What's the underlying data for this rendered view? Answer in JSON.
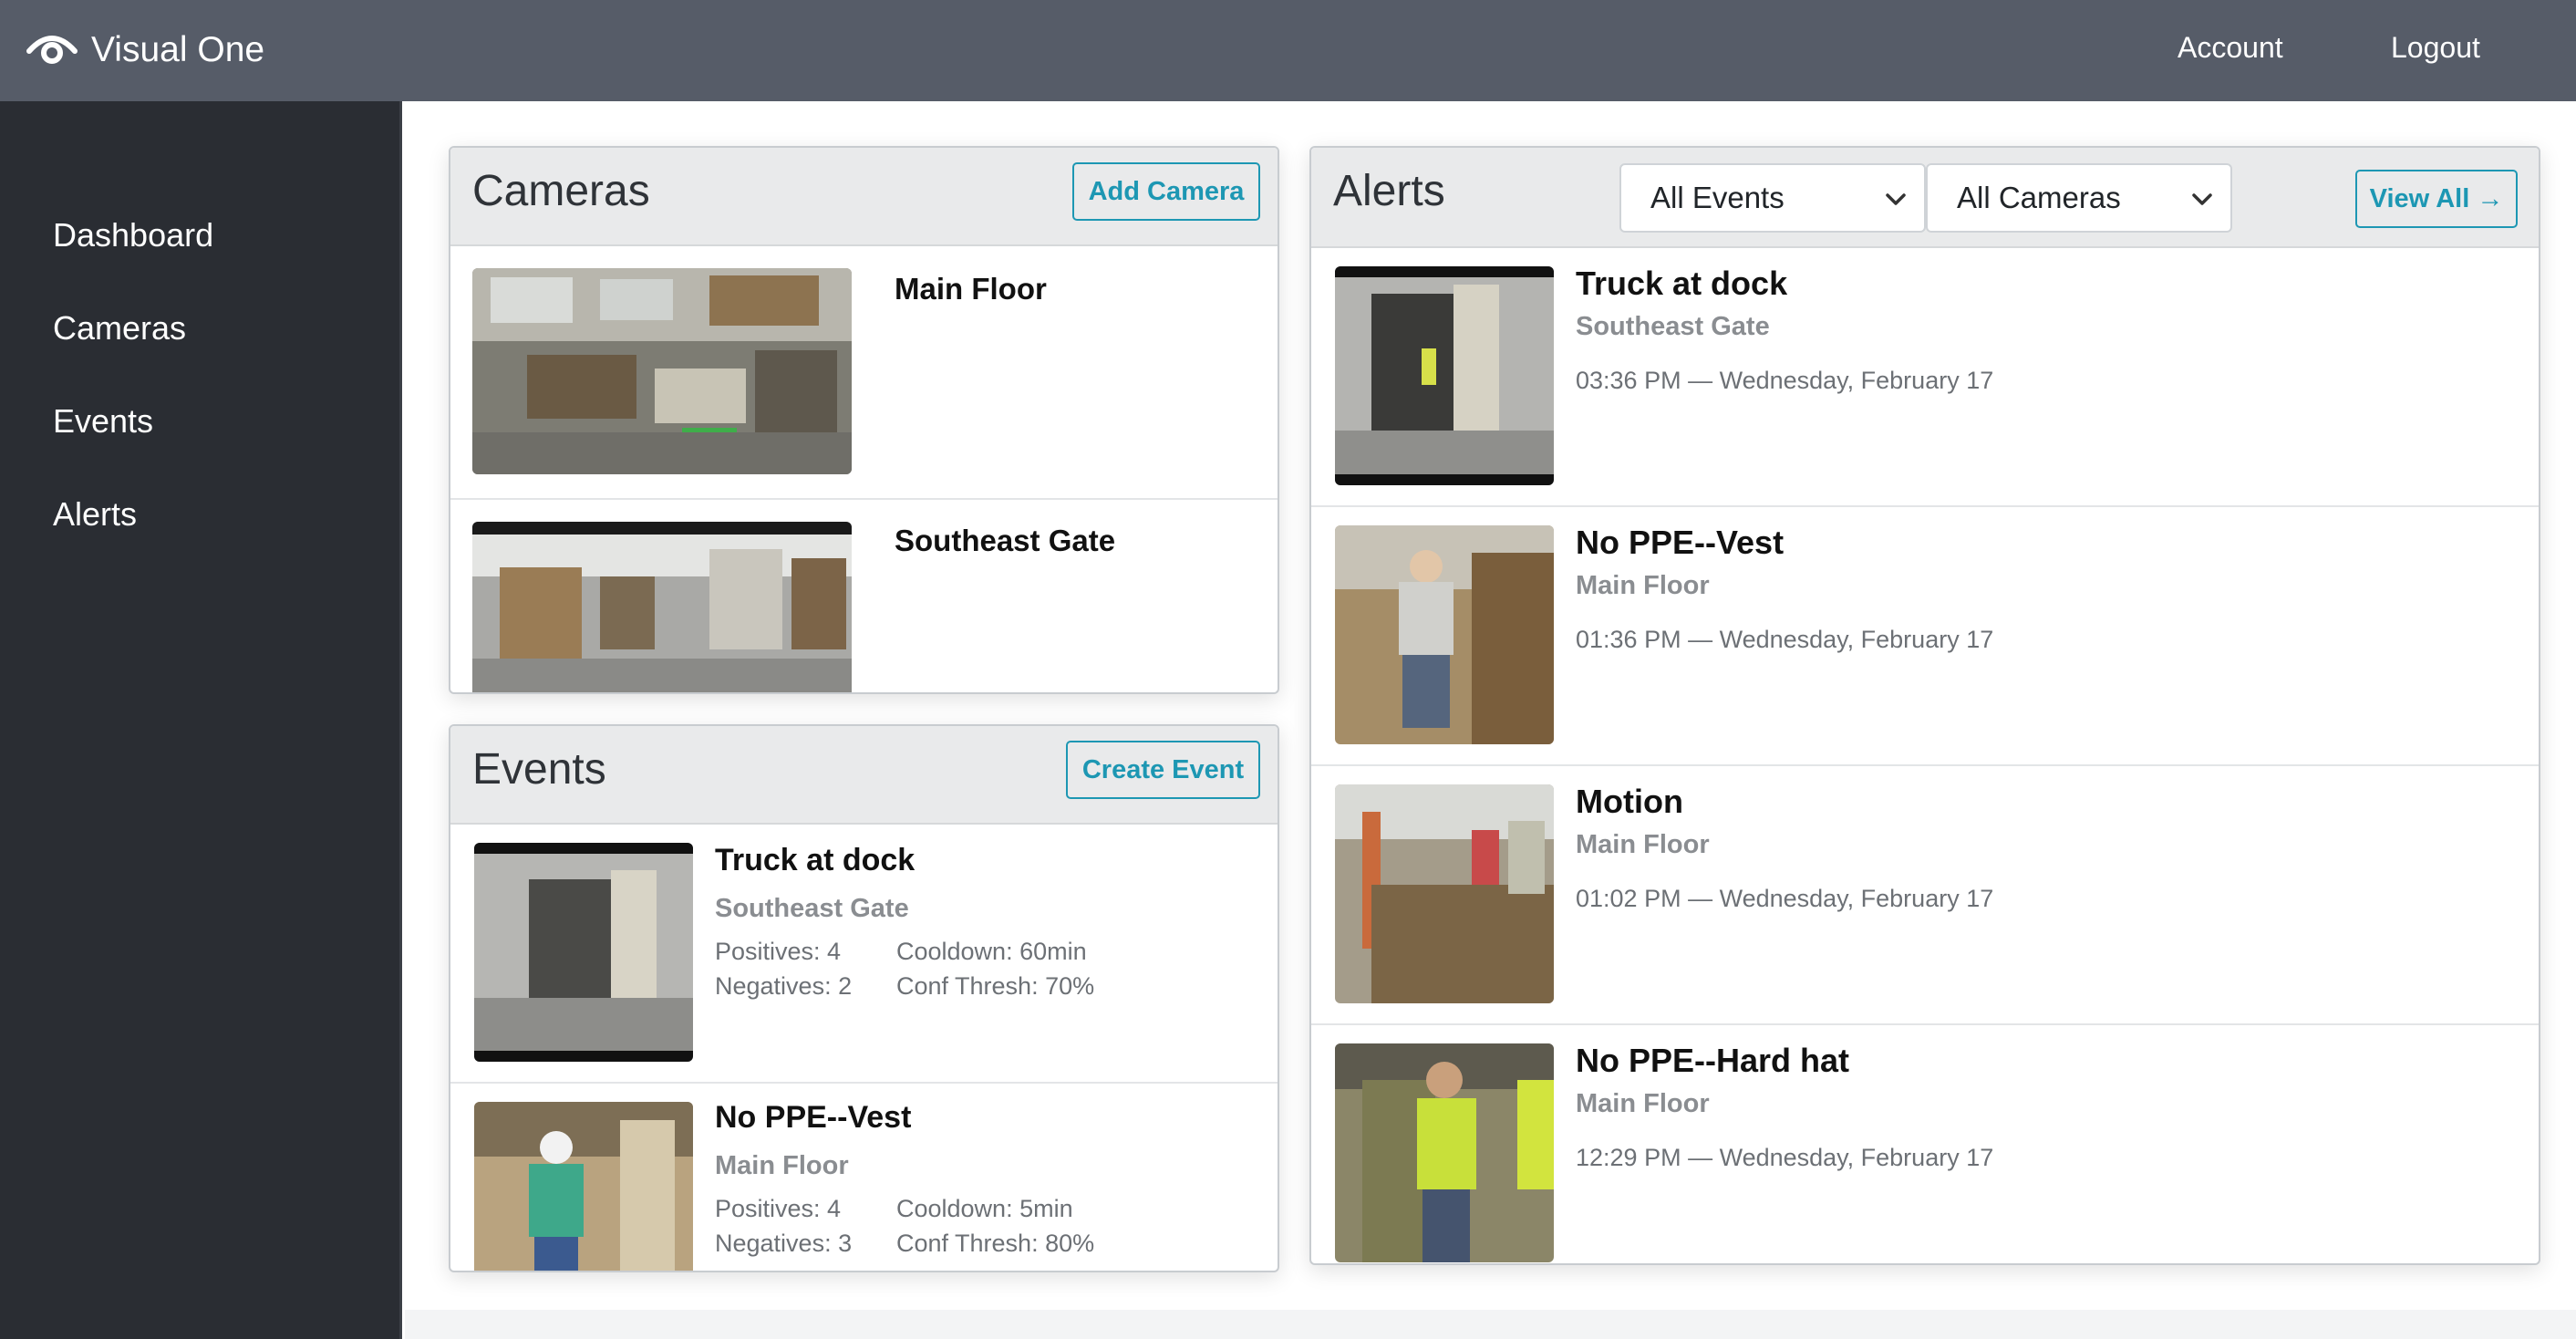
{
  "brand": {
    "name": "Visual One",
    "icon": "eye-icon"
  },
  "nav": {
    "account": "Account",
    "logout": "Logout"
  },
  "sidebar": {
    "items": [
      {
        "label": "Dashboard"
      },
      {
        "label": "Cameras"
      },
      {
        "label": "Events"
      },
      {
        "label": "Alerts"
      }
    ]
  },
  "cameras": {
    "title": "Cameras",
    "add_button": "Add Camera",
    "items": [
      {
        "name": "Main Floor"
      },
      {
        "name": "Southeast Gate"
      }
    ]
  },
  "events": {
    "title": "Events",
    "create_button": "Create Event",
    "items": [
      {
        "title": "Truck at dock",
        "camera": "Southeast Gate",
        "positives": "Positives: 4",
        "negatives": "Negatives: 2",
        "cooldown": "Cooldown: 60min",
        "conf_thresh": "Conf Thresh: 70%"
      },
      {
        "title": "No PPE--Vest",
        "camera": "Main Floor",
        "positives": "Positives: 4",
        "negatives": "Negatives: 3",
        "cooldown": "Cooldown: 5min",
        "conf_thresh": "Conf Thresh: 80%"
      }
    ]
  },
  "alerts": {
    "title": "Alerts",
    "event_filter": "All Events",
    "camera_filter": "All Cameras",
    "view_all": "View All →",
    "items": [
      {
        "title": "Truck at dock",
        "camera": "Southeast Gate",
        "time": "03:36 PM — Wednesday, February 17"
      },
      {
        "title": "No PPE--Vest",
        "camera": "Main Floor",
        "time": "01:36 PM — Wednesday, February 17"
      },
      {
        "title": "Motion",
        "camera": "Main Floor",
        "time": "01:02 PM — Wednesday, February 17"
      },
      {
        "title": "No PPE--Hard hat",
        "camera": "Main Floor",
        "time": "12:29 PM — Wednesday, February 17"
      }
    ]
  },
  "colors": {
    "navbar": "#565c68",
    "sidebar": "#2a2d33",
    "accent": "#1d97b3"
  }
}
